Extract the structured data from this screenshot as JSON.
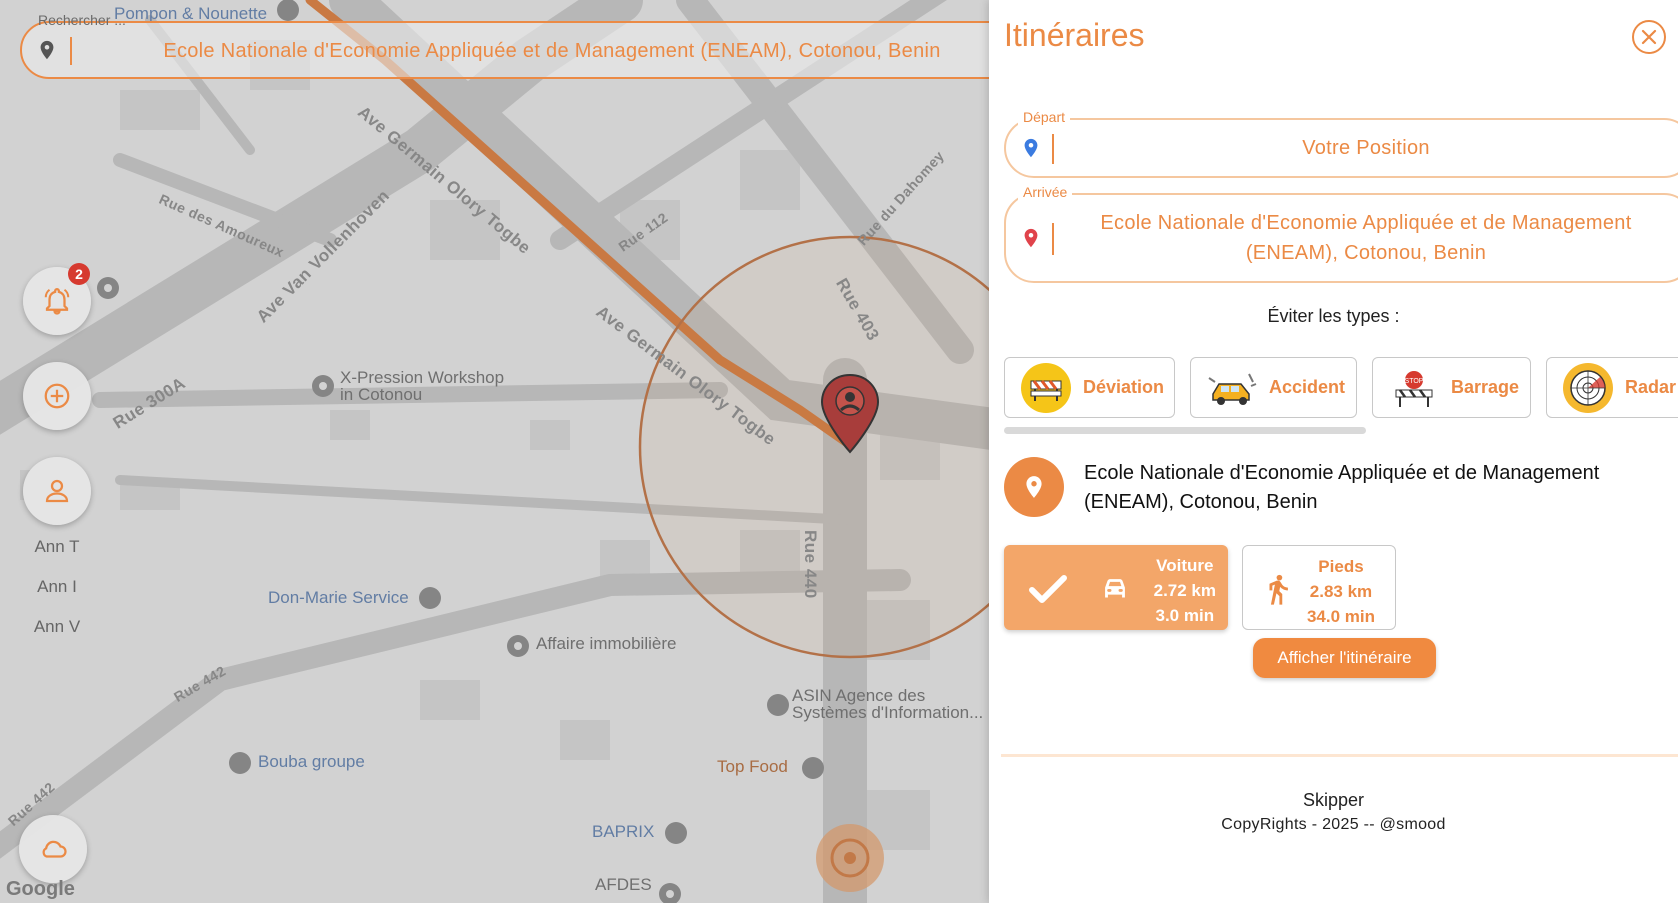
{
  "map": {
    "search": {
      "label": "Rechercher ...",
      "value": "Ecole Nationale d'Economie Appliquée et de Management (ENEAM), Cotonou, Benin"
    },
    "notifications_badge": "2",
    "users": [
      "Ann T",
      "Ann I",
      "Ann V"
    ],
    "places": {
      "pompon": "Pompon & Nounette",
      "xpression": "X-Pression Workshop in Cotonou",
      "donmarie": "Don-Marie Service",
      "affaire": "Affaire immobilière",
      "asin": "ASIN Agence des Systèmes d'Information...",
      "bouba": "Bouba groupe",
      "topfood": "Top Food",
      "baprix": "BAPRIX",
      "afdes": "AFDES"
    },
    "streets": {
      "germain1": "Ave Germain Olory Togbe",
      "germain2": "Ave Germain Olory Togbe",
      "vollenhoven": "Ave Van Vollenhoven",
      "amoureux": "Rue des Amoureux",
      "rue300a": "Rue 300A",
      "rue112": "Rue 112",
      "rue403": "Rue 403",
      "rue440": "Rue 440",
      "rue442a": "Rue 442",
      "rue442b": "Rue 442",
      "dahomey": "Rue du Dahomey"
    },
    "attribution": "Google"
  },
  "panel": {
    "title": "Itinéraires",
    "depart": {
      "legend": "Départ",
      "value": "Votre Position"
    },
    "arrivee": {
      "legend": "Arrivée",
      "value": "Ecole Nationale d'Economie Appliquée et de Management (ENEAM), Cotonou, Benin"
    },
    "avoid_title": "Éviter les types :",
    "avoid_types": [
      "Déviation",
      "Accident",
      "Barrage",
      "Radar"
    ],
    "destination": "Ecole Nationale d'Economie Appliquée et de Management (ENEAM), Cotonou, Benin",
    "modes": {
      "car": {
        "label": "Voiture",
        "distance": "2.72 km",
        "duration": "3.0 min"
      },
      "walk": {
        "label": "Pieds",
        "distance": "2.83 km",
        "duration": "34.0 min"
      }
    },
    "show_route": "Afficher l'itinéraire",
    "footer": {
      "name": "Skipper",
      "copyright": "CopyRights - 2025 -- @smood"
    }
  },
  "colors": {
    "accent": "#eb8a45",
    "accent_light": "#f3a669",
    "badge": "#d63a2f"
  }
}
